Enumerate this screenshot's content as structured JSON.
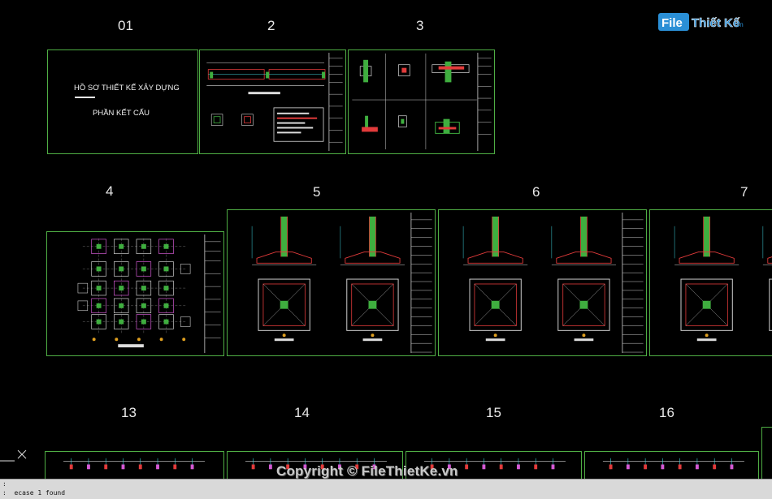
{
  "sheets": [
    {
      "id": "01",
      "label": "01"
    },
    {
      "id": "2",
      "label": "2"
    },
    {
      "id": "3",
      "label": "3"
    },
    {
      "id": "4",
      "label": "4"
    },
    {
      "id": "5",
      "label": "5"
    },
    {
      "id": "6",
      "label": "6"
    },
    {
      "id": "7",
      "label": "7"
    },
    {
      "id": "13",
      "label": "13"
    },
    {
      "id": "14",
      "label": "14"
    },
    {
      "id": "15",
      "label": "15"
    },
    {
      "id": "16",
      "label": "16"
    }
  ],
  "cover": {
    "title": "HỒ SƠ THIẾT KẾ XÂY DỰNG",
    "subtitle": "PHẦN KẾT CẤU"
  },
  "watermark": {
    "logo_part1": "File",
    "logo_part2": "Thiết Kế",
    "logo_suffix": ".vn",
    "copyright": "Copyright © FileThietKe.vn"
  },
  "command_line": {
    "line1": ":",
    "line2": ":  ecase 1 found"
  },
  "colors": {
    "sheet_border": "#4fae44",
    "background": "#000000",
    "rebar_red": "#e23b3b",
    "column_green": "#3fae3f",
    "dimension_cyan": "#3fd6e0",
    "logo_blue": "#2a8fd6"
  }
}
